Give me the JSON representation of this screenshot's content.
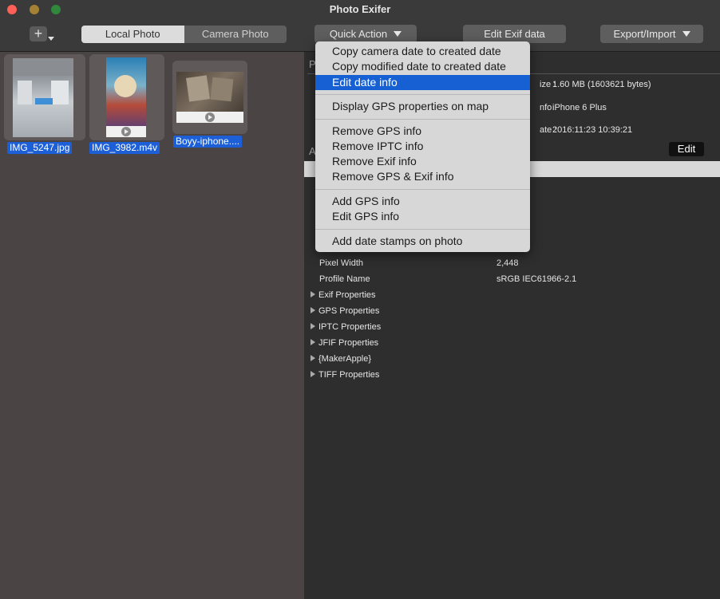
{
  "window": {
    "title": "Photo Exifer"
  },
  "toolbar": {
    "add_label": "+",
    "segments": [
      "Local Photo",
      "Camera Photo"
    ],
    "quick_action_label": "Quick Action",
    "edit_exif_label": "Edit Exif data",
    "export_import_label": "Export/Import"
  },
  "files": [
    {
      "name": "IMG_5247.jpg",
      "type": "photo"
    },
    {
      "name": "IMG_3982.m4v",
      "type": "video"
    },
    {
      "name": "Boyy-iphone....",
      "type": "video"
    }
  ],
  "details": {
    "section_header_partial": "P",
    "file_size_label": "ize :",
    "file_size_value": "1.60 MB (1603621 bytes)",
    "camera_label": "nfo :",
    "camera_value": "iPhone 6 Plus",
    "date_label": "ate :",
    "date_value": "2016:11:23 10:39:21",
    "attributes_header_partial": "A",
    "edit_label": "Edit"
  },
  "properties": [
    {
      "key": "Pixel Width",
      "value": "2,448"
    },
    {
      "key": "Profile Name",
      "value": "sRGB IEC61966-2.1"
    }
  ],
  "groups": [
    "Exif Properties",
    "GPS Properties",
    "IPTC Properties",
    "JFIF Properties",
    "{MakerApple}",
    "TIFF Properties"
  ],
  "menu": {
    "items": [
      "Copy camera date to created date",
      "Copy modified date to created date",
      "Edit date info",
      "Display GPS properties on map",
      "Remove GPS info",
      "Remove IPTC info",
      "Remove Exif info",
      "Remove GPS & Exif info",
      "Add GPS info",
      "Edit GPS  info",
      "Add date stamps on photo"
    ],
    "highlighted": "Edit date info"
  },
  "colors": {
    "accent": "#1660d3",
    "close": "#fe5f57",
    "minimize": "#febc2e",
    "maximize": "#28c840"
  }
}
